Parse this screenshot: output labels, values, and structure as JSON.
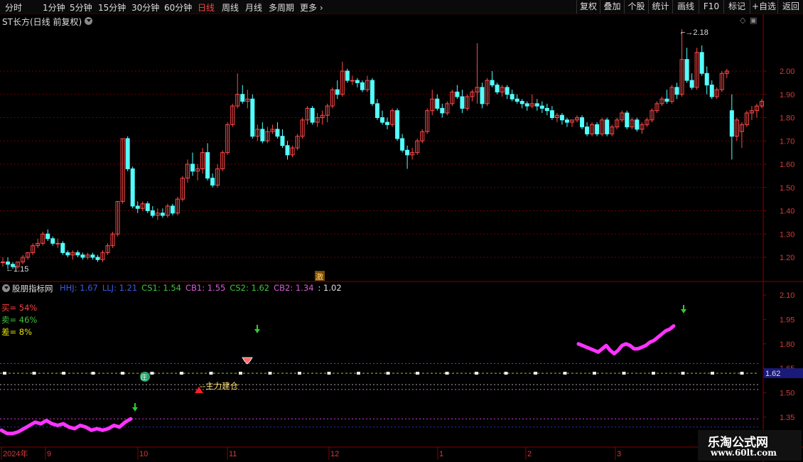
{
  "toolbar": {
    "periods": [
      "分时",
      "1分钟",
      "5分钟",
      "15分钟",
      "30分钟",
      "60分钟",
      "日线",
      "周线",
      "月线",
      "多周期",
      "更多"
    ],
    "active_period": "日线",
    "right_buttons": [
      "复权",
      "叠加",
      "个股",
      "统计",
      "画线",
      "F10",
      "标记",
      "+自选",
      "返回"
    ]
  },
  "main_chart": {
    "title": "ST长方(日线 前复权)",
    "y_ticks": [
      "2.00",
      "1.90",
      "1.80",
      "1.70",
      "1.60",
      "1.50",
      "1.40",
      "1.30",
      "1.20"
    ],
    "high_marker": "2.18",
    "low_marker": "1.15",
    "event_badge": "激"
  },
  "indicator": {
    "name": "股朋指标网",
    "values": [
      {
        "label": "HHJ: 1.67",
        "color": "#3b5bdb"
      },
      {
        "label": "LLJ: 1.21",
        "color": "#3b5bdb"
      },
      {
        "label": "CS1: 1.54",
        "color": "#3ec43e"
      },
      {
        "label": "CB1: 1.55",
        "color": "#d65cd6"
      },
      {
        "label": "CS2: 1.62",
        "color": "#3ec43e"
      },
      {
        "label": "CB2: 1.34",
        "color": "#d65cd6"
      },
      {
        "label": ": 1.02",
        "color": "#e0e0e0"
      }
    ],
    "stats": [
      {
        "label": "买= 54%",
        "color": "#ff4040"
      },
      {
        "label": "卖= 46%",
        "color": "#3ec43e"
      },
      {
        "label": "差= 8%",
        "color": "#e6e600"
      }
    ],
    "y_ticks": [
      "2.10",
      "1.95",
      "1.80",
      "1.65",
      "1.50",
      "1.35"
    ],
    "current_value": "1.62",
    "annotation": "主力建仓",
    "badge_char": "庄"
  },
  "x_axis": {
    "labels": [
      "2024年",
      "9",
      "10",
      "11",
      "12",
      "1",
      "2",
      "3"
    ]
  },
  "watermark": {
    "line1": "乐淘公式网",
    "line2": "www.60lt.com"
  },
  "colors": {
    "up": "#ff4a4a",
    "down": "#54ffff",
    "grid": "#6b0000",
    "magenta": "#ff33ff",
    "green_line": "#8acd2c",
    "blue_dash": "#4a4aff"
  },
  "chart_data": {
    "type": "candlestick",
    "price_range": [
      1.14,
      2.22
    ],
    "indicator_range": [
      1.25,
      2.15
    ],
    "candles": [
      [
        1.18,
        1.2,
        1.16,
        1.18
      ],
      [
        1.18,
        1.2,
        1.15,
        1.17
      ],
      [
        1.17,
        1.18,
        1.15,
        1.16
      ],
      [
        1.16,
        1.18,
        1.15,
        1.18
      ],
      [
        1.18,
        1.21,
        1.17,
        1.2
      ],
      [
        1.2,
        1.22,
        1.19,
        1.22
      ],
      [
        1.22,
        1.26,
        1.21,
        1.25
      ],
      [
        1.25,
        1.28,
        1.24,
        1.26
      ],
      [
        1.26,
        1.31,
        1.25,
        1.3
      ],
      [
        1.3,
        1.32,
        1.27,
        1.28
      ],
      [
        1.28,
        1.29,
        1.25,
        1.26
      ],
      [
        1.26,
        1.28,
        1.24,
        1.26
      ],
      [
        1.26,
        1.27,
        1.21,
        1.22
      ],
      [
        1.22,
        1.23,
        1.2,
        1.21
      ],
      [
        1.21,
        1.23,
        1.19,
        1.22
      ],
      [
        1.22,
        1.23,
        1.2,
        1.21
      ],
      [
        1.21,
        1.22,
        1.19,
        1.2
      ],
      [
        1.2,
        1.22,
        1.19,
        1.21
      ],
      [
        1.21,
        1.22,
        1.19,
        1.2
      ],
      [
        1.2,
        1.21,
        1.18,
        1.19
      ],
      [
        1.19,
        1.23,
        1.18,
        1.22
      ],
      [
        1.22,
        1.26,
        1.21,
        1.25
      ],
      [
        1.25,
        1.31,
        1.24,
        1.3
      ],
      [
        1.3,
        1.44,
        1.29,
        1.44
      ],
      [
        1.44,
        1.71,
        1.43,
        1.71
      ],
      [
        1.71,
        1.72,
        1.57,
        1.58
      ],
      [
        1.58,
        1.59,
        1.41,
        1.42
      ],
      [
        1.42,
        1.44,
        1.39,
        1.41
      ],
      [
        1.41,
        1.44,
        1.4,
        1.43
      ],
      [
        1.43,
        1.44,
        1.39,
        1.4
      ],
      [
        1.4,
        1.42,
        1.37,
        1.38
      ],
      [
        1.38,
        1.41,
        1.36,
        1.39
      ],
      [
        1.39,
        1.41,
        1.37,
        1.38
      ],
      [
        1.38,
        1.43,
        1.37,
        1.42
      ],
      [
        1.42,
        1.43,
        1.38,
        1.39
      ],
      [
        1.39,
        1.46,
        1.38,
        1.45
      ],
      [
        1.45,
        1.55,
        1.44,
        1.54
      ],
      [
        1.54,
        1.62,
        1.52,
        1.6
      ],
      [
        1.6,
        1.65,
        1.55,
        1.57
      ],
      [
        1.57,
        1.6,
        1.53,
        1.58
      ],
      [
        1.58,
        1.67,
        1.56,
        1.65
      ],
      [
        1.65,
        1.69,
        1.53,
        1.54
      ],
      [
        1.54,
        1.56,
        1.5,
        1.51
      ],
      [
        1.51,
        1.6,
        1.5,
        1.58
      ],
      [
        1.58,
        1.66,
        1.57,
        1.65
      ],
      [
        1.65,
        1.78,
        1.64,
        1.77
      ],
      [
        1.77,
        1.86,
        1.76,
        1.85
      ],
      [
        1.85,
        1.99,
        1.84,
        1.9
      ],
      [
        1.9,
        1.94,
        1.86,
        1.87
      ],
      [
        1.87,
        1.92,
        1.84,
        1.88
      ],
      [
        1.88,
        1.9,
        1.71,
        1.72
      ],
      [
        1.72,
        1.77,
        1.7,
        1.75
      ],
      [
        1.75,
        1.78,
        1.69,
        1.7
      ],
      [
        1.7,
        1.76,
        1.69,
        1.74
      ],
      [
        1.74,
        1.77,
        1.73,
        1.75
      ],
      [
        1.75,
        1.78,
        1.71,
        1.72
      ],
      [
        1.72,
        1.75,
        1.67,
        1.68
      ],
      [
        1.68,
        1.7,
        1.62,
        1.64
      ],
      [
        1.64,
        1.68,
        1.63,
        1.67
      ],
      [
        1.67,
        1.73,
        1.66,
        1.72
      ],
      [
        1.72,
        1.8,
        1.71,
        1.79
      ],
      [
        1.79,
        1.85,
        1.77,
        1.84
      ],
      [
        1.84,
        1.85,
        1.77,
        1.78
      ],
      [
        1.78,
        1.82,
        1.76,
        1.8
      ],
      [
        1.8,
        1.83,
        1.77,
        1.81
      ],
      [
        1.81,
        1.86,
        1.78,
        1.85
      ],
      [
        1.85,
        1.93,
        1.84,
        1.92
      ],
      [
        1.92,
        1.96,
        1.88,
        1.9
      ],
      [
        1.9,
        2.04,
        1.89,
        2.0
      ],
      [
        2.0,
        2.01,
        1.95,
        1.96
      ],
      [
        1.96,
        1.98,
        1.94,
        1.96
      ],
      [
        1.96,
        1.97,
        1.93,
        1.95
      ],
      [
        1.95,
        1.96,
        1.91,
        1.92
      ],
      [
        1.92,
        1.98,
        1.91,
        1.96
      ],
      [
        1.96,
        1.97,
        1.85,
        1.86
      ],
      [
        1.86,
        1.88,
        1.79,
        1.8
      ],
      [
        1.8,
        1.83,
        1.77,
        1.78
      ],
      [
        1.78,
        1.8,
        1.75,
        1.77
      ],
      [
        1.77,
        1.84,
        1.76,
        1.83
      ],
      [
        1.83,
        1.84,
        1.7,
        1.71
      ],
      [
        1.71,
        1.73,
        1.65,
        1.66
      ],
      [
        1.66,
        1.68,
        1.58,
        1.64
      ],
      [
        1.64,
        1.67,
        1.62,
        1.65
      ],
      [
        1.65,
        1.71,
        1.64,
        1.7
      ],
      [
        1.7,
        1.75,
        1.69,
        1.74
      ],
      [
        1.74,
        1.84,
        1.73,
        1.83
      ],
      [
        1.83,
        1.92,
        1.81,
        1.88
      ],
      [
        1.88,
        1.9,
        1.83,
        1.84
      ],
      [
        1.84,
        1.86,
        1.8,
        1.82
      ],
      [
        1.82,
        1.87,
        1.81,
        1.86
      ],
      [
        1.86,
        1.92,
        1.85,
        1.91
      ],
      [
        1.91,
        1.94,
        1.88,
        1.89
      ],
      [
        1.89,
        1.92,
        1.82,
        1.84
      ],
      [
        1.84,
        1.9,
        1.83,
        1.89
      ],
      [
        1.89,
        1.92,
        1.87,
        1.91
      ],
      [
        1.91,
        2.12,
        1.86,
        1.93
      ],
      [
        1.93,
        1.95,
        1.84,
        1.86
      ],
      [
        1.86,
        1.97,
        1.85,
        1.96
      ],
      [
        1.96,
        2.0,
        1.93,
        1.94
      ],
      [
        1.94,
        1.95,
        1.9,
        1.91
      ],
      [
        1.91,
        1.94,
        1.89,
        1.93
      ],
      [
        1.93,
        1.94,
        1.88,
        1.9
      ],
      [
        1.9,
        1.92,
        1.87,
        1.88
      ],
      [
        1.88,
        1.9,
        1.86,
        1.87
      ],
      [
        1.87,
        1.88,
        1.84,
        1.86
      ],
      [
        1.86,
        1.87,
        1.83,
        1.85
      ],
      [
        1.85,
        1.9,
        1.84,
        1.86
      ],
      [
        1.86,
        1.88,
        1.83,
        1.85
      ],
      [
        1.85,
        1.87,
        1.82,
        1.84
      ],
      [
        1.84,
        1.86,
        1.81,
        1.83
      ],
      [
        1.83,
        1.85,
        1.79,
        1.8
      ],
      [
        1.8,
        1.82,
        1.78,
        1.81
      ],
      [
        1.81,
        1.82,
        1.77,
        1.79
      ],
      [
        1.79,
        1.8,
        1.76,
        1.78
      ],
      [
        1.78,
        1.79,
        1.76,
        1.79
      ],
      [
        1.79,
        1.81,
        1.78,
        1.8
      ],
      [
        1.8,
        1.81,
        1.75,
        1.76
      ],
      [
        1.76,
        1.78,
        1.72,
        1.73
      ],
      [
        1.73,
        1.78,
        1.72,
        1.77
      ],
      [
        1.77,
        1.78,
        1.72,
        1.73
      ],
      [
        1.73,
        1.8,
        1.72,
        1.79
      ],
      [
        1.79,
        1.8,
        1.72,
        1.73
      ],
      [
        1.73,
        1.77,
        1.72,
        1.76
      ],
      [
        1.76,
        1.8,
        1.75,
        1.79
      ],
      [
        1.79,
        1.83,
        1.78,
        1.82
      ],
      [
        1.82,
        1.83,
        1.75,
        1.76
      ],
      [
        1.76,
        1.8,
        1.75,
        1.79
      ],
      [
        1.79,
        1.8,
        1.74,
        1.75
      ],
      [
        1.75,
        1.78,
        1.73,
        1.77
      ],
      [
        1.77,
        1.8,
        1.76,
        1.79
      ],
      [
        1.79,
        1.84,
        1.78,
        1.83
      ],
      [
        1.83,
        1.87,
        1.82,
        1.86
      ],
      [
        1.86,
        1.89,
        1.85,
        1.88
      ],
      [
        1.88,
        1.92,
        1.86,
        1.87
      ],
      [
        1.87,
        1.94,
        1.86,
        1.93
      ],
      [
        1.93,
        1.95,
        1.88,
        1.9
      ],
      [
        1.9,
        2.18,
        1.89,
        2.05
      ],
      [
        2.05,
        2.1,
        1.95,
        1.96
      ],
      [
        1.96,
        1.99,
        1.92,
        1.93
      ],
      [
        1.93,
        2.1,
        1.92,
        2.08
      ],
      [
        2.08,
        2.11,
        1.98,
        1.99
      ],
      [
        1.99,
        2.02,
        1.9,
        1.94
      ],
      [
        1.94,
        1.96,
        1.88,
        1.89
      ],
      [
        1.89,
        1.93,
        1.88,
        1.92
      ],
      [
        1.92,
        2.0,
        1.91,
        1.99
      ],
      [
        1.99,
        2.01,
        1.97,
        2.0
      ],
      [
        1.83,
        1.9,
        1.62,
        1.72
      ],
      [
        1.72,
        1.8,
        1.7,
        1.79
      ],
      [
        1.74,
        1.78,
        1.67,
        1.77
      ],
      [
        1.77,
        1.83,
        1.76,
        1.82
      ],
      [
        1.82,
        1.85,
        1.79,
        1.83
      ],
      [
        1.83,
        1.86,
        1.8,
        1.85
      ],
      [
        1.85,
        1.88,
        1.84,
        1.87
      ]
    ],
    "magenta_left": [
      1.27,
      1.25,
      1.25,
      1.26,
      1.28,
      1.3,
      1.32,
      1.31,
      1.33,
      1.31,
      1.3,
      1.31,
      1.29,
      1.28,
      1.3,
      1.29,
      1.27,
      1.28,
      1.27,
      1.28,
      1.3,
      1.29,
      1.32,
      1.34
    ],
    "magenta_right": [
      1.8,
      1.79,
      1.78,
      1.77,
      1.76,
      1.75,
      1.77,
      1.79,
      1.76,
      1.74,
      1.76,
      1.79,
      1.8,
      1.79,
      1.77,
      1.77,
      1.78,
      1.79,
      1.81,
      1.82,
      1.84,
      1.86,
      1.88,
      1.89,
      1.91
    ]
  }
}
